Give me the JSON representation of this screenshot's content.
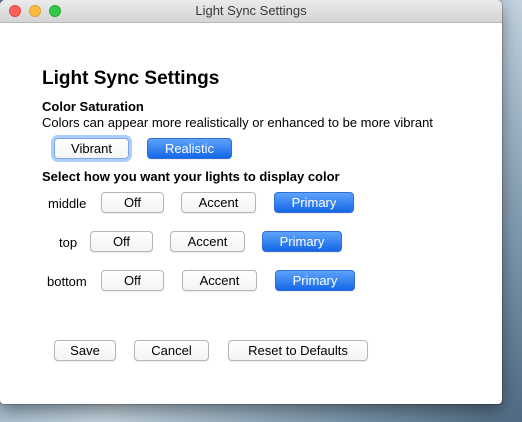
{
  "window": {
    "title": "Light Sync Settings"
  },
  "page": {
    "heading": "Light Sync Settings",
    "saturation": {
      "title": "Color Saturation",
      "description": "Colors can appear more realistically or enhanced to be more vibrant",
      "options": [
        "Vibrant",
        "Realistic"
      ],
      "selected": "Realistic"
    },
    "display": {
      "title": "Select how you want your lights to display color",
      "rows": [
        {
          "label": "middle",
          "options": [
            "Off",
            "Accent",
            "Primary"
          ],
          "selected": "Primary"
        },
        {
          "label": "top",
          "options": [
            "Off",
            "Accent",
            "Primary"
          ],
          "selected": "Primary"
        },
        {
          "label": "bottom",
          "options": [
            "Off",
            "Accent",
            "Primary"
          ],
          "selected": "Primary"
        }
      ]
    },
    "actions": {
      "save": "Save",
      "cancel": "Cancel",
      "reset": "Reset to Defaults"
    }
  },
  "colors": {
    "accent": "#1467e8",
    "close": "#fc605c",
    "minimize": "#fdbc40",
    "maximize": "#34c84a"
  }
}
